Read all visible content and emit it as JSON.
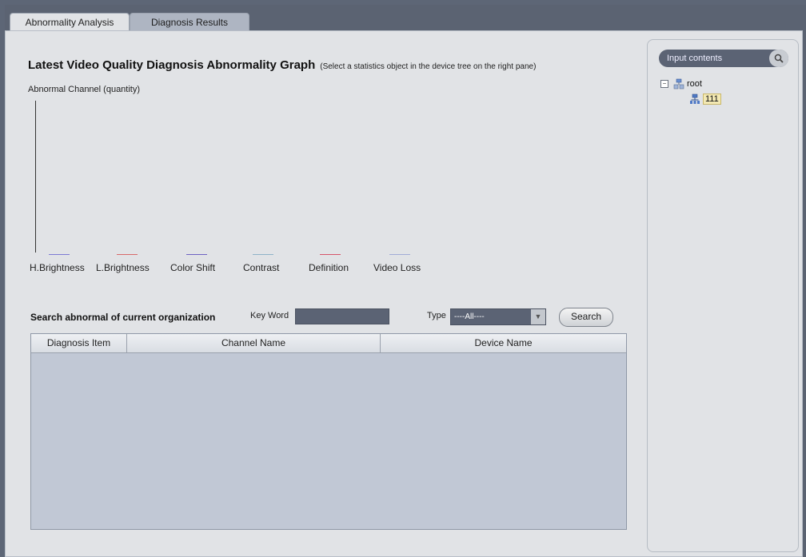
{
  "tabs": [
    {
      "label": "Abnormality Analysis",
      "active": true
    },
    {
      "label": "Diagnosis Results",
      "active": false
    }
  ],
  "graph": {
    "title": "Latest Video Quality Diagnosis Abnormality Graph",
    "hint": "(Select a statistics object in the device tree on the right pane)",
    "y_axis_label": "Abnormal Channel (quantity)"
  },
  "chart_data": {
    "type": "bar",
    "categories": [
      "H.Brightness",
      "L.Brightness",
      "Color Shift",
      "Contrast",
      "Definition",
      "Video Loss"
    ],
    "values": [
      0,
      0,
      0,
      0,
      0,
      0
    ],
    "series_colors": [
      "#7d7bd4",
      "#d76a6a",
      "#6d63c2",
      "#8fb3c8",
      "#d5546a",
      "#a2acd6"
    ],
    "ylabel": "Abnormal Channel (quantity)"
  },
  "search": {
    "title": "Search abnormal of current organization",
    "keyword_label": "Key Word",
    "keyword_value": "",
    "type_label": "Type",
    "type_value": "----All----",
    "button_label": "Search"
  },
  "table": {
    "columns": [
      "Diagnosis Item",
      "Channel Name",
      "Device Name"
    ],
    "rows": []
  },
  "tree": {
    "search_placeholder": "Input contents",
    "root_label": "root",
    "child_label": "111"
  },
  "colors": {
    "accent_dark": "#5b6374",
    "panel_bg": "#e1e3e6",
    "table_bg": "#c1c8d5"
  }
}
